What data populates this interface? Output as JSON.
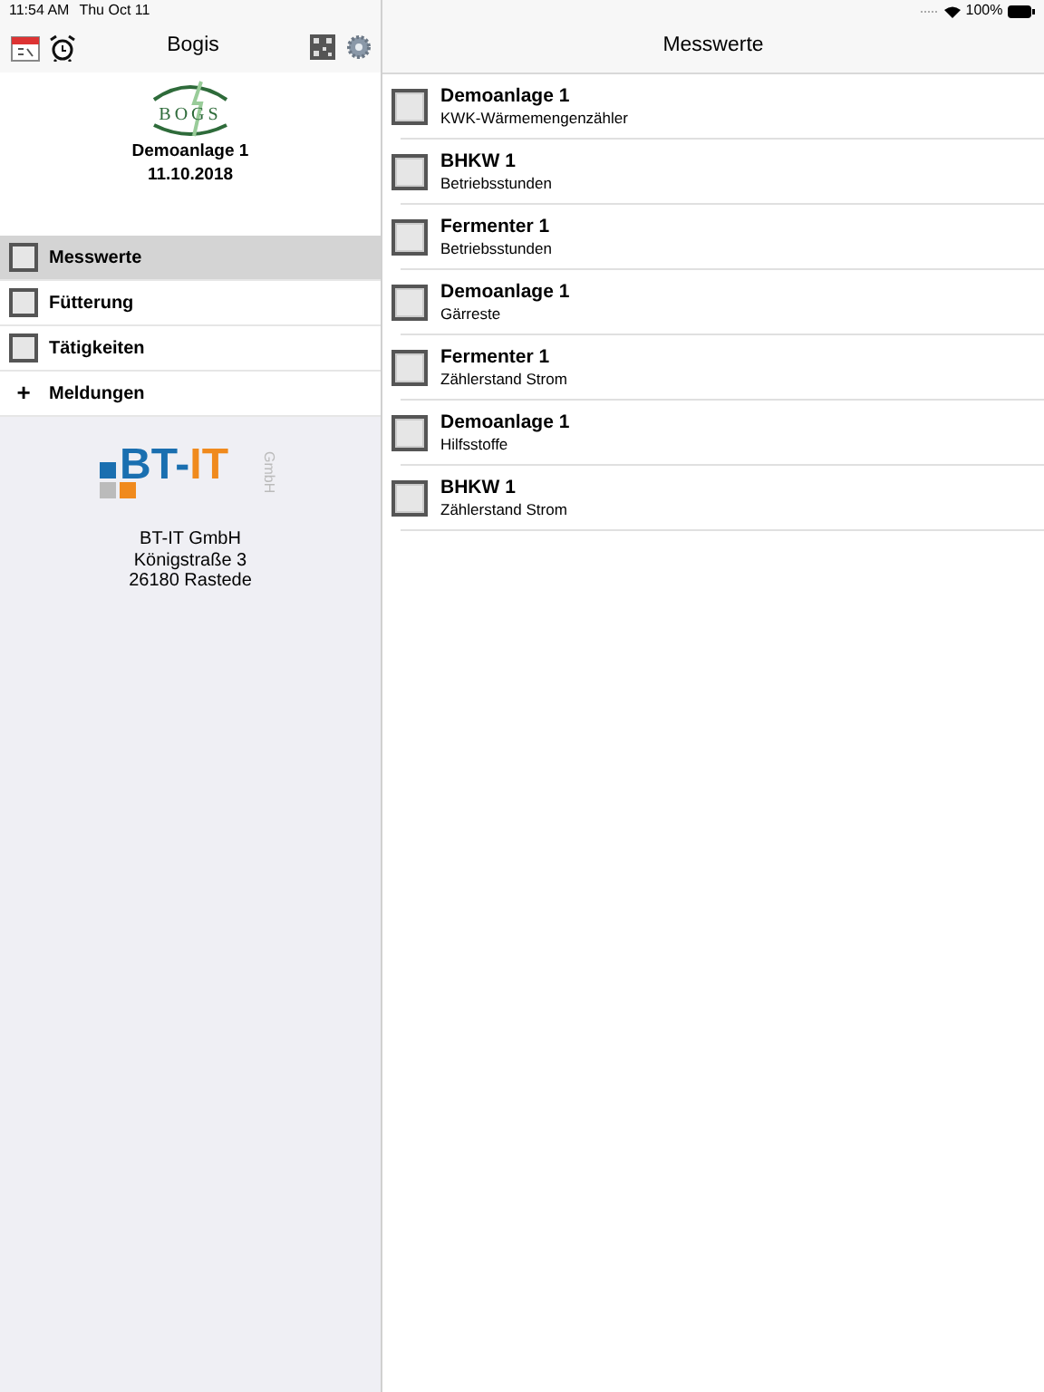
{
  "status_bar": {
    "time": "11:54 AM",
    "date": "Thu Oct 11",
    "battery": "100%"
  },
  "sidebar": {
    "title": "Bogis",
    "logo_text": "BOGS",
    "plant": "Demoanlage 1",
    "date": "11.10.2018",
    "items": [
      {
        "kind": "box",
        "label": "Messwerte",
        "selected": true
      },
      {
        "kind": "box",
        "label": "Fütterung",
        "selected": false
      },
      {
        "kind": "box",
        "label": "Tätigkeiten",
        "selected": false
      },
      {
        "kind": "plus",
        "symbol": "+",
        "label": "Meldungen",
        "selected": false
      }
    ],
    "company": {
      "logo_text": "BT-IT",
      "logo_suffix": "GmbH",
      "lines": [
        "BT-IT GmbH",
        "Königstraße 3",
        "26180 Rastede"
      ]
    }
  },
  "main": {
    "title": "Messwerte",
    "rows": [
      {
        "title": "Demoanlage 1",
        "subtitle": "KWK-Wärmemengenzähler"
      },
      {
        "title": "BHKW 1",
        "subtitle": "Betriebsstunden"
      },
      {
        "title": "Fermenter 1",
        "subtitle": "Betriebsstunden"
      },
      {
        "title": "Demoanlage 1",
        "subtitle": "Gärreste"
      },
      {
        "title": "Fermenter 1",
        "subtitle": "Zählerstand Strom"
      },
      {
        "title": "Demoanlage 1",
        "subtitle": "Hilfsstoffe"
      },
      {
        "title": "BHKW 1",
        "subtitle": "Zählerstand Strom"
      }
    ]
  }
}
